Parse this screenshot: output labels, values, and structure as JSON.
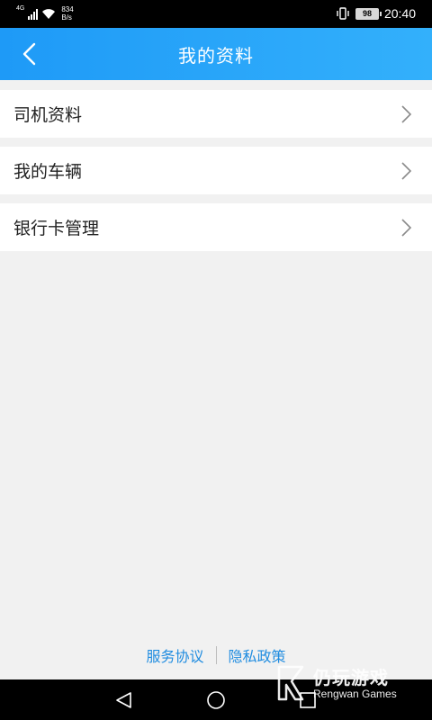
{
  "status_bar": {
    "network_type": "4G",
    "speed_value": "834",
    "speed_unit": "B/s",
    "battery_level": "98",
    "time": "20:40"
  },
  "header": {
    "title": "我的资料",
    "back_icon": "chevron-left-icon",
    "background_color": "#2aa6f9"
  },
  "menu": {
    "items": [
      {
        "label": "司机资料",
        "icon": "chevron-right-icon"
      },
      {
        "label": "我的车辆",
        "icon": "chevron-right-icon"
      },
      {
        "label": "银行卡管理",
        "icon": "chevron-right-icon"
      }
    ]
  },
  "footer": {
    "service_agreement": "服务协议",
    "privacy_policy": "隐私政策",
    "link_color": "#1f8ce0"
  },
  "nav_bar": {
    "back_icon": "triangle-back-icon",
    "home_icon": "circle-home-icon",
    "recents_icon": "square-recents-icon"
  },
  "watermark": {
    "name_cn": "仍玩游戏",
    "name_en": "Rengwan Games"
  }
}
